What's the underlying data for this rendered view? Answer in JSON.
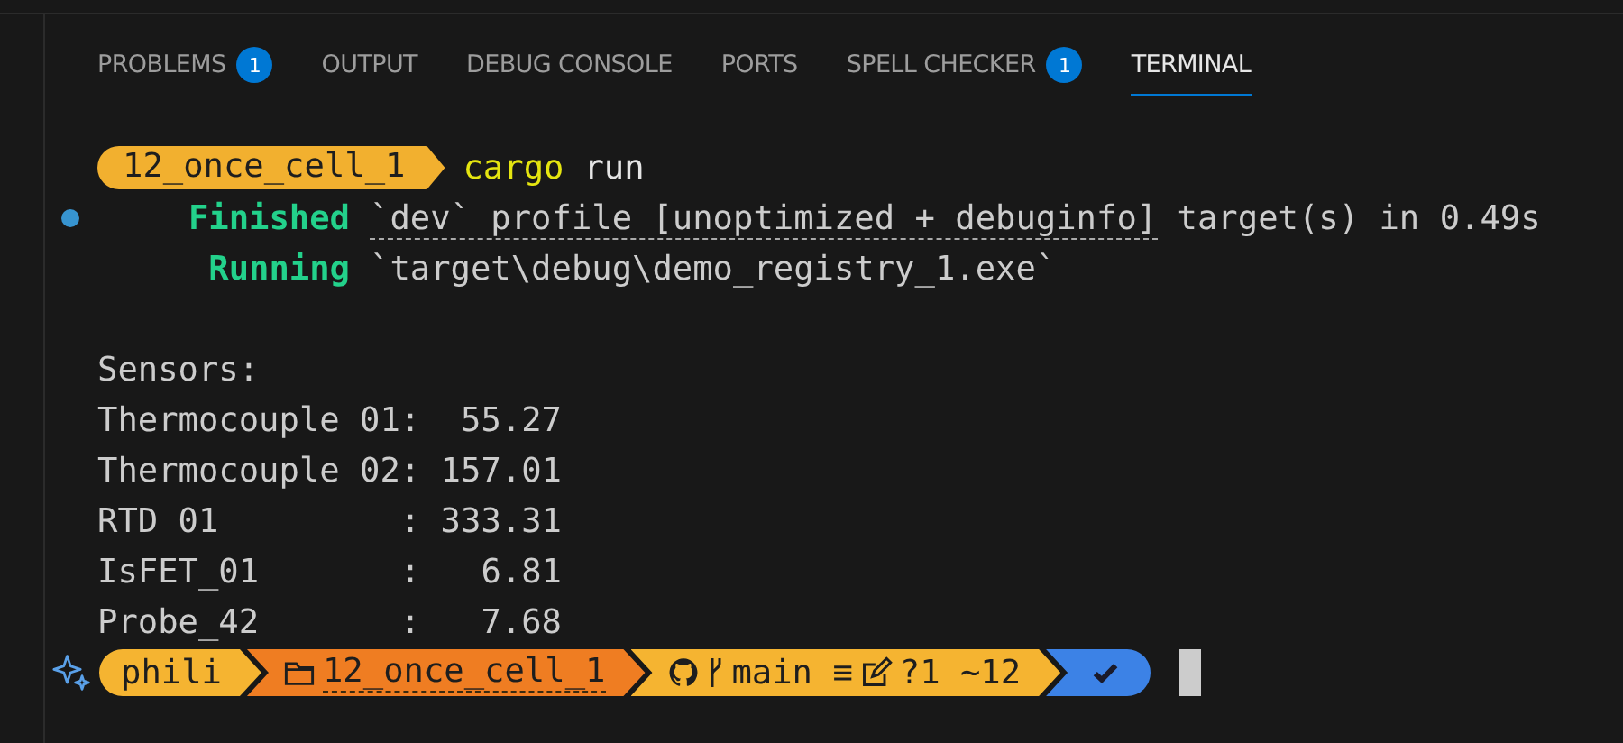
{
  "tabs": [
    {
      "label": "PROBLEMS",
      "badge": "1",
      "selected": false
    },
    {
      "label": "OUTPUT",
      "selected": false
    },
    {
      "label": "DEBUG CONSOLE",
      "selected": false
    },
    {
      "label": "PORTS",
      "selected": false
    },
    {
      "label": "SPELL CHECKER",
      "badge": "1",
      "selected": false
    },
    {
      "label": "TERMINAL",
      "selected": true
    }
  ],
  "terminal": {
    "command_prompt": {
      "directory": "12_once_cell_1",
      "command": "cargo",
      "argument": "run"
    },
    "lines": [
      {
        "kind": "status",
        "marker": true,
        "label": "Finished",
        "link": "`dev` profile [unoptimized + debuginfo]",
        "text": " target(s) in 0.49s"
      },
      {
        "kind": "status",
        "marker": false,
        "label": "Running",
        "text": "`target\\debug\\demo_registry_1.exe`"
      },
      {
        "kind": "blank"
      },
      {
        "kind": "output",
        "text": "Sensors:"
      },
      {
        "kind": "output",
        "text": "Thermocouple 01:  55.27"
      },
      {
        "kind": "output",
        "text": "Thermocouple 02: 157.01"
      },
      {
        "kind": "output",
        "text": "RTD 01         : 333.31"
      },
      {
        "kind": "output",
        "text": "IsFET_01       :   6.81"
      },
      {
        "kind": "output",
        "text": "Probe_42       :   7.68"
      }
    ],
    "prompt": [
      {
        "kind": "user",
        "text": "phili",
        "color": "#f5b431"
      },
      {
        "kind": "folder",
        "text": "12_once_cell_1",
        "color": "#ef7d22"
      },
      {
        "kind": "git",
        "branch": "main ≡",
        "changes": "?1 ~12",
        "color": "#f5b431"
      },
      {
        "kind": "status",
        "color": "#3c82e6"
      }
    ]
  }
}
